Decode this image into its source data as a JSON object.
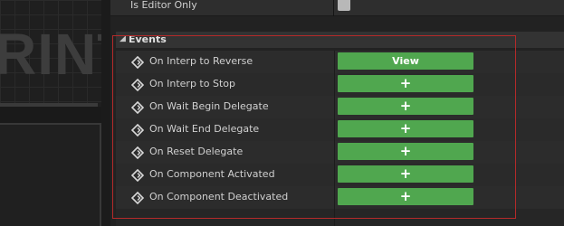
{
  "viewport": {
    "watermark_text": "RINT"
  },
  "details": {
    "editor_only_label": "Is Editor Only",
    "editor_only_checked": false,
    "section": {
      "title": "Events",
      "expanded": true
    },
    "events": [
      {
        "label": "On Interp to Reverse",
        "action": "View"
      },
      {
        "label": "On Interp to Stop",
        "action": "+"
      },
      {
        "label": "On Wait Begin Delegate",
        "action": "+"
      },
      {
        "label": "On Wait End Delegate",
        "action": "+"
      },
      {
        "label": "On Reset Delegate",
        "action": "+"
      },
      {
        "label": "On Component Activated",
        "action": "+"
      },
      {
        "label": "On Component Deactivated",
        "action": "+"
      }
    ]
  },
  "colors": {
    "button_green": "#50a74f",
    "highlight_red": "#b52a2a",
    "panel_background": "#222222"
  }
}
